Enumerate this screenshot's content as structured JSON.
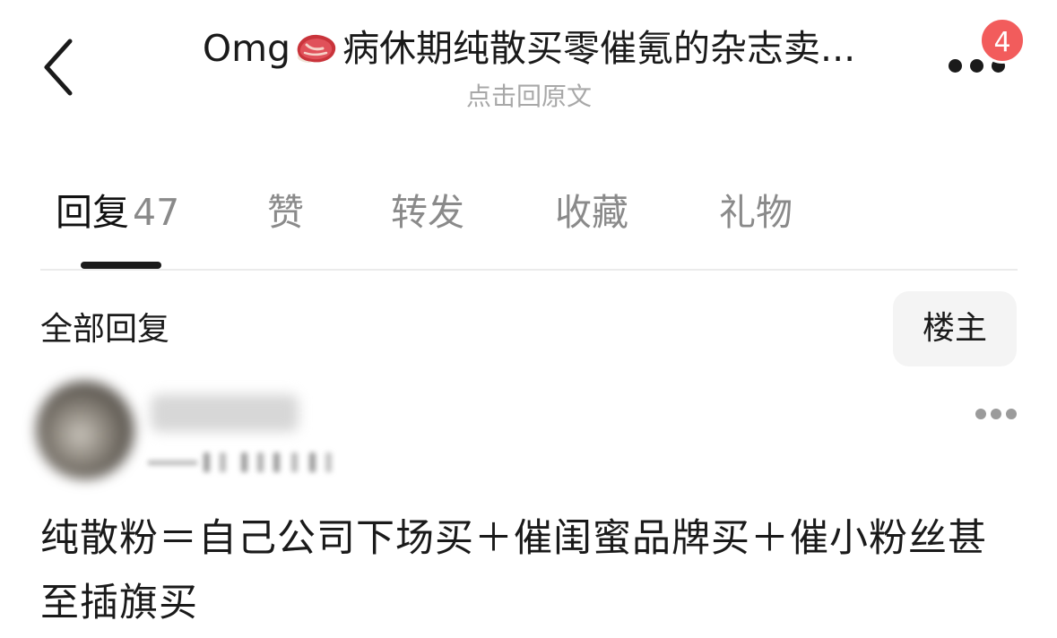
{
  "header": {
    "title": "Omg",
    "title_suffix": "病休期纯散买零催氪的杂志卖...",
    "title_emoji_icon": "steak-emoji-icon",
    "subtitle": "点击回原文",
    "notification_count": "4"
  },
  "tabs": [
    {
      "label": "回复",
      "count": "47"
    },
    {
      "label": "赞"
    },
    {
      "label": "转发"
    },
    {
      "label": "收藏"
    },
    {
      "label": "礼物"
    }
  ],
  "section": {
    "title": "全部回复",
    "filter_label": "楼主"
  },
  "comment": {
    "text": "纯散粉＝自己公司下场买＋催闺蜜品牌买＋催小粉丝甚至插旗买"
  },
  "colors": {
    "badge": "#f25c5c",
    "muted_text": "#a8a8a8",
    "tab_inactive": "#8a8a8a",
    "filter_bg": "#f4f4f4"
  }
}
